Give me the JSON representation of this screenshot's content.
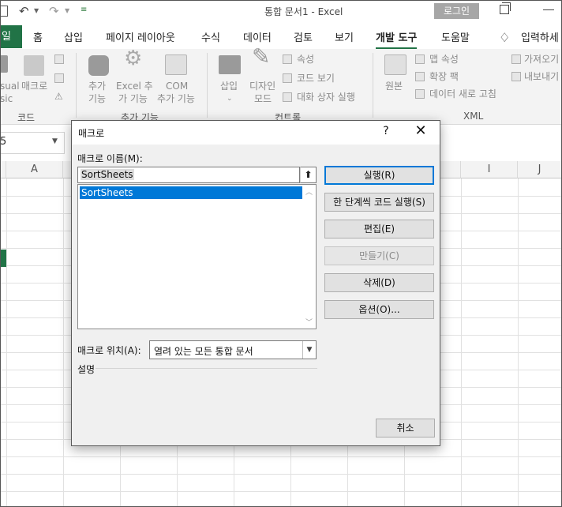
{
  "titlebar": {
    "undo_icon": "undo-icon",
    "redo_icon": "redo-icon",
    "title": "통합 문서1  -  Excel",
    "login_label": "로그인"
  },
  "tabs": [
    {
      "label": "일"
    },
    {
      "label": "홈"
    },
    {
      "label": "삽입"
    },
    {
      "label": "페이지 레이아웃"
    },
    {
      "label": "수식"
    },
    {
      "label": "데이터"
    },
    {
      "label": "검토"
    },
    {
      "label": "보기"
    },
    {
      "label": "개발 도구"
    },
    {
      "label": "도움말"
    }
  ],
  "tell_me": "입력하세",
  "ribbon": {
    "code": {
      "visual_basic_1": "sual",
      "visual_basic_2": "sic",
      "macro": "매크로",
      "group": "코드"
    },
    "addins": {
      "addin_1": "추가",
      "addin_2": "기능",
      "excel_addin_1": "Excel 추",
      "excel_addin_2": "가 기능",
      "com_addin_1": "COM",
      "com_addin_2": "추가 기능",
      "group": "추가 기능"
    },
    "controls": {
      "insert": "삽입",
      "design_mode_1": "디자인",
      "design_mode_2": "모드",
      "properties": "속성",
      "view_code": "코드 보기",
      "run_dialog": "대화 상자 실행",
      "group": "컨트롤"
    },
    "xml": {
      "source": "원본",
      "map_properties": "맵 속성",
      "expansion_packs": "확장 팩",
      "refresh_data": "데이터 새로 고침",
      "import": "가져오기",
      "export": "내보내기",
      "group": "XML"
    }
  },
  "namebox": {
    "value": "5"
  },
  "columns": [
    "A",
    "I",
    "J"
  ],
  "dialog": {
    "title": "매크로",
    "help": "?",
    "close": "✕",
    "macro_name_label": "매크로 이름(M):",
    "macro_name_value": "SortSheets",
    "macros": [
      "SortSheets"
    ],
    "buttons": {
      "run": "실행(R)",
      "step_into": "한 단계씩 코드 실행(S)",
      "edit": "편집(E)",
      "create": "만들기(C)",
      "delete": "삭제(D)",
      "options": "옵션(O)...",
      "cancel": "취소"
    },
    "macros_in_label": "매크로 위치(A):",
    "macros_in_value": "열려 있는 모든 통합 문서",
    "description_label": "설명"
  }
}
